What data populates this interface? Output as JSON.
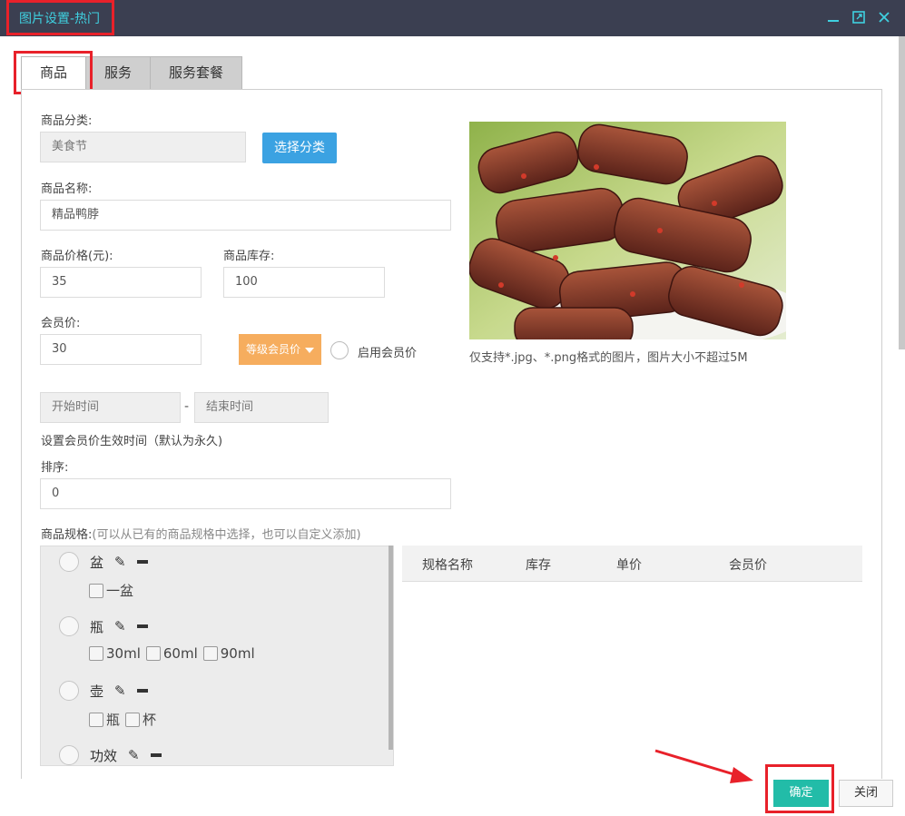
{
  "window": {
    "title": "图片设置-热门",
    "icons": [
      "minimize-icon",
      "maximize-icon",
      "close-icon"
    ]
  },
  "tabs": [
    {
      "label": "商品",
      "active": true
    },
    {
      "label": "服务",
      "active": false
    },
    {
      "label": "服务套餐",
      "active": false
    }
  ],
  "form": {
    "category_label": "商品分类:",
    "category_value": "美食节",
    "select_category_button": "选择分类",
    "name_label": "商品名称:",
    "name_value": "精品鸭脖",
    "price_label": "商品价格(元):",
    "price_value": "35",
    "stock_label": "商品库存:",
    "stock_value": "100",
    "member_price_label": "会员价:",
    "member_price_value": "30",
    "level_member_price_button": "等级会员价",
    "enable_member_price_label": "启用会员价",
    "start_time_placeholder": "开始时间",
    "end_time_placeholder": "结束时间",
    "time_separator": "-",
    "time_hint": "设置会员价生效时间（默认为永久)",
    "sort_label": "排序:",
    "sort_value": "0",
    "spec_label": "商品规格:",
    "spec_hint": "(可以从已有的商品规格中选择，也可以自定义添加)"
  },
  "image_note": "仅支持*.jpg、*.png格式的图片，图片大小不超过5M",
  "spec_groups": [
    {
      "name": "盆",
      "options": [
        "一盆"
      ]
    },
    {
      "name": "瓶",
      "options": [
        "30ml",
        "60ml",
        "90ml"
      ]
    },
    {
      "name": "壶",
      "options": [
        "瓶",
        "杯"
      ]
    },
    {
      "name": "功效",
      "options": []
    }
  ],
  "spec_table": {
    "columns": [
      "规格名称",
      "库存",
      "单价",
      "会员价"
    ]
  },
  "footer": {
    "ok_button": "确定",
    "close_button": "关闭"
  },
  "colors": {
    "titlebar": "#3b3f51",
    "title_text": "#3fd0e0",
    "highlight": "#e8212a",
    "blue_button": "#3ba2e2",
    "orange_button": "#f6ad5e",
    "ok_button": "#22bca8"
  }
}
